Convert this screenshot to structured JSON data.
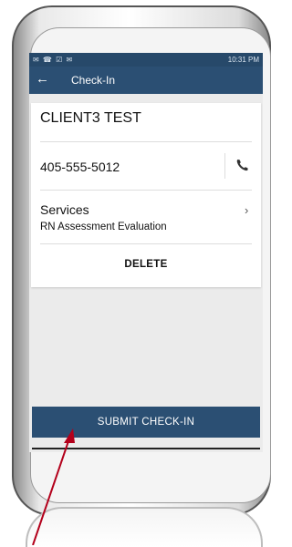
{
  "status_bar": {
    "left_icons": "✉ ☎ ☑ ✉",
    "time": "10:31 PM"
  },
  "app_bar": {
    "title": "Check-In",
    "back_icon": "arrow-left-icon"
  },
  "client": {
    "name": "CLIENT3 TEST",
    "phone": "405-555-5012"
  },
  "services": {
    "label": "Services",
    "items": [
      "RN Assessment Evaluation"
    ]
  },
  "actions": {
    "delete_label": "DELETE",
    "submit_label": "SUBMIT CHECK-IN"
  },
  "colors": {
    "primary": "#2b4f73",
    "annotation_arrow": "#b3001b"
  }
}
